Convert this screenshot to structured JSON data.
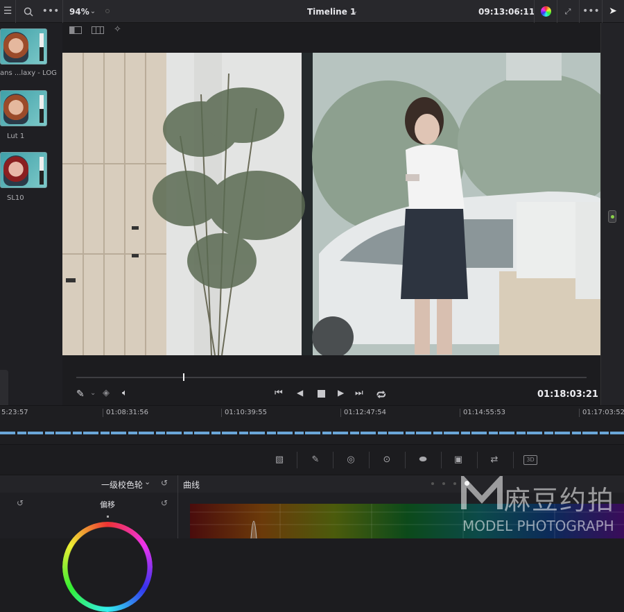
{
  "topbar": {
    "zoom": "94%",
    "timeline_name": "Timeline 1",
    "timecode": "09:13:06:11"
  },
  "gallery": {
    "stills": [
      {
        "label": "ans ...laxy - LOG"
      },
      {
        "label": "Lut 1"
      },
      {
        "label": "SL10"
      }
    ]
  },
  "viewer": {
    "playback_timecode": "01:18:03:21"
  },
  "timeline_ruler": {
    "ticks": [
      "5:23:57",
      "01:08:31:56",
      "01:10:39:55",
      "01:12:47:54",
      "01:14:55:53",
      "01:17:03:52"
    ]
  },
  "color_panel": {
    "wheels_mode": "一级校色轮",
    "curves_title": "曲线",
    "offset_label": "偏移"
  },
  "watermark": {
    "logo_text": "麻豆约拍",
    "sub_text": "MODEL PHOTOGRAPH"
  },
  "colors": {
    "accent_track": "#6aa6d8",
    "node_green": "#8bd14a"
  }
}
